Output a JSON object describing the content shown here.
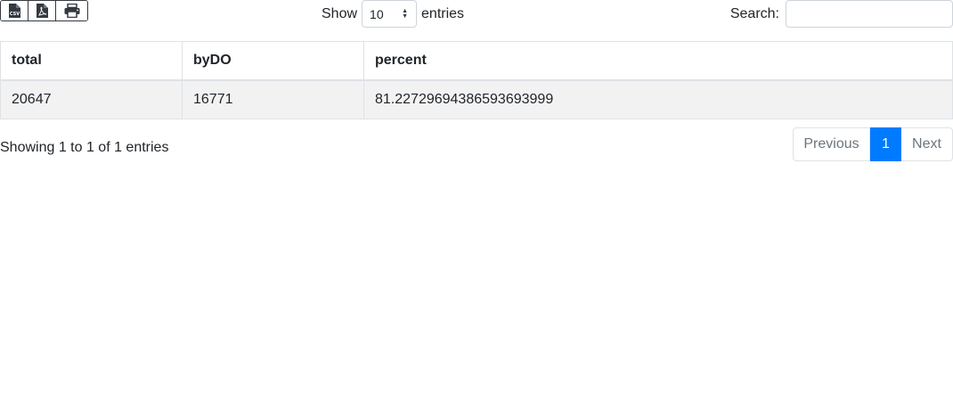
{
  "toolbar": {
    "buttons": [
      {
        "icon": "csv-file-icon",
        "label": "CSV"
      },
      {
        "icon": "pdf-file-icon",
        "label": "PDF"
      },
      {
        "icon": "print-icon",
        "label": "Print"
      }
    ]
  },
  "length": {
    "prefix": "Show",
    "selected": "10",
    "suffix": "entries"
  },
  "search": {
    "label": "Search:",
    "value": "",
    "placeholder": ""
  },
  "table": {
    "columns": [
      "total",
      "byDO",
      "percent"
    ],
    "rows": [
      [
        "20647",
        "16771",
        "81.22729694386593693999"
      ]
    ]
  },
  "info": {
    "text": "Showing 1 to 1 of 1 entries"
  },
  "pagination": {
    "previous": "Previous",
    "current": "1",
    "next": "Next",
    "accent_color": "#007bff"
  }
}
